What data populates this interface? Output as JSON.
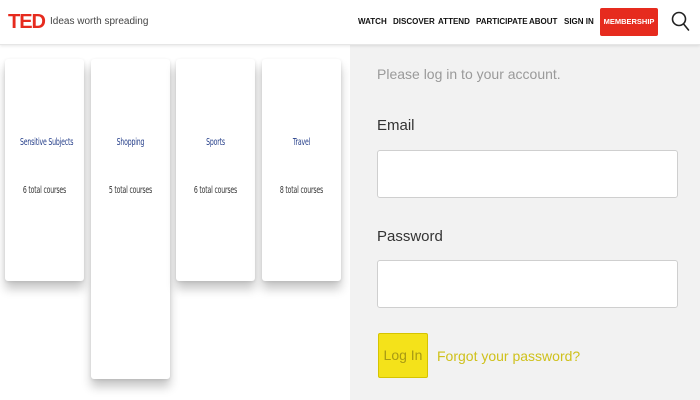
{
  "header": {
    "logo": "TED",
    "tagline": "Ideas worth spreading",
    "nav": [
      "WATCH",
      "DISCOVER",
      "ATTEND",
      "PARTICIPATE",
      "ABOUT",
      "SIGN IN"
    ],
    "membership_label": "MEMBERSHIP",
    "search_icon": "search-icon",
    "brand_color": "#e62b1e"
  },
  "cards": [
    {
      "title": "Sensitive Subjects",
      "subtitle": "6 total courses"
    },
    {
      "title": "Shopping",
      "subtitle": "5 total courses"
    },
    {
      "title": "Sports",
      "subtitle": "6 total courses"
    },
    {
      "title": "Travel",
      "subtitle": "8 total courses"
    }
  ],
  "login": {
    "prompt": "Please log in to your account.",
    "email_label": "Email",
    "email_value": "",
    "password_label": "Password",
    "password_value": "",
    "login_button": "Log In",
    "forgot_link": "Forgot your password?",
    "button_color": "#f4e21a"
  }
}
